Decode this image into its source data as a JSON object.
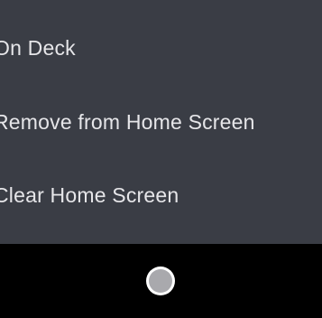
{
  "menu": {
    "items": [
      {
        "label": "On Deck"
      },
      {
        "label": "Remove from Home Screen"
      },
      {
        "label": "Clear Home Screen"
      }
    ]
  },
  "nav_bar": {
    "home_button_icon": "home-circle-icon"
  },
  "colors": {
    "menu_background": "#3a3d45",
    "menu_text": "#e6e6e9",
    "nav_background": "#000000",
    "home_button_fill": "#a9a9ad"
  }
}
